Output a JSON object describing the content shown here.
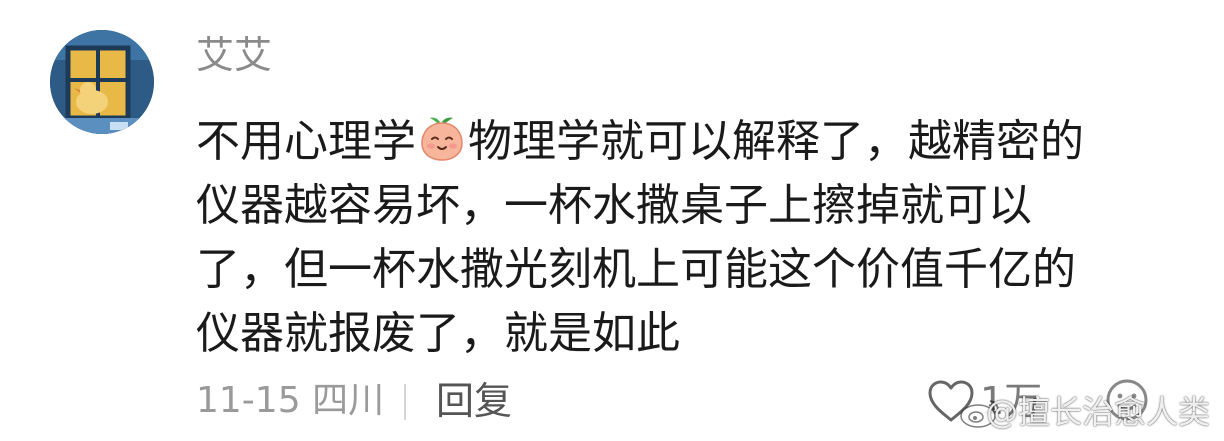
{
  "comment": {
    "username": "艾艾",
    "text_lines": [
      {
        "before": "不用心理学",
        "emoji": "peach-face-emoji",
        "after": "物理学就可以解释了，越精密的"
      },
      {
        "text": "仪器越容易坏，一杯水撒桌子上擦掉就可以"
      },
      {
        "text": "了，但一杯水撒光刻机上可能这个价值千亿的"
      },
      {
        "text": "仪器就报废了，就是如此"
      }
    ],
    "date": "11-15",
    "location": "四川",
    "reply_label": "回复",
    "like_count": "1万"
  },
  "watermark": {
    "text": "@擅长治愈人类"
  },
  "colors": {
    "username": "#8a8a8a",
    "body_text": "#1a1a1a",
    "meta_text": "#9a9a9a",
    "reply_text": "#555555"
  },
  "icons": [
    "avatar-illustration",
    "peach-face-emoji",
    "heart-outline-icon",
    "emoji-face-icon",
    "weibo-logo-icon"
  ]
}
